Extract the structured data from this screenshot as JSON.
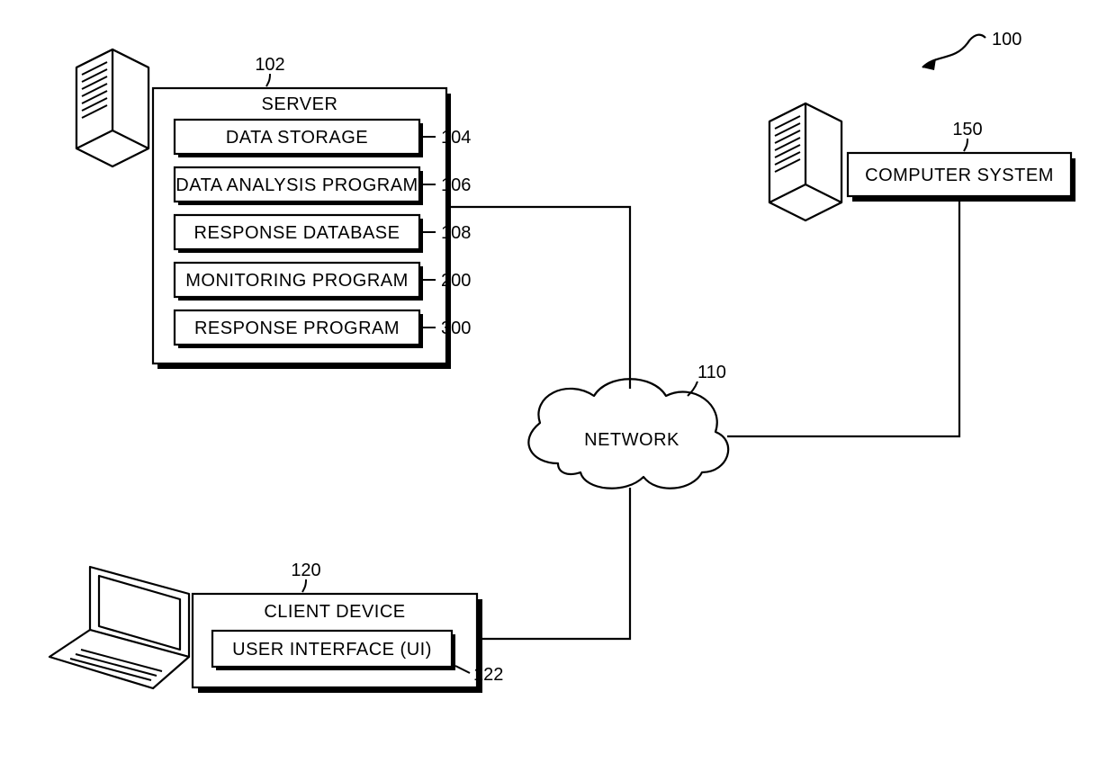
{
  "figure_ref": "100",
  "server": {
    "ref": "102",
    "title": "SERVER",
    "items": [
      {
        "label": "DATA STORAGE",
        "ref": "104"
      },
      {
        "label": "DATA ANALYSIS PROGRAM",
        "ref": "106"
      },
      {
        "label": "RESPONSE DATABASE",
        "ref": "108"
      },
      {
        "label": "MONITORING PROGRAM",
        "ref": "200"
      },
      {
        "label": "RESPONSE PROGRAM",
        "ref": "300"
      }
    ]
  },
  "network": {
    "ref": "110",
    "label": "NETWORK"
  },
  "computer_system": {
    "ref": "150",
    "title": "COMPUTER SYSTEM"
  },
  "client_device": {
    "ref": "120",
    "title": "CLIENT DEVICE",
    "item": {
      "label": "USER INTERFACE (UI)",
      "ref": "122"
    }
  }
}
